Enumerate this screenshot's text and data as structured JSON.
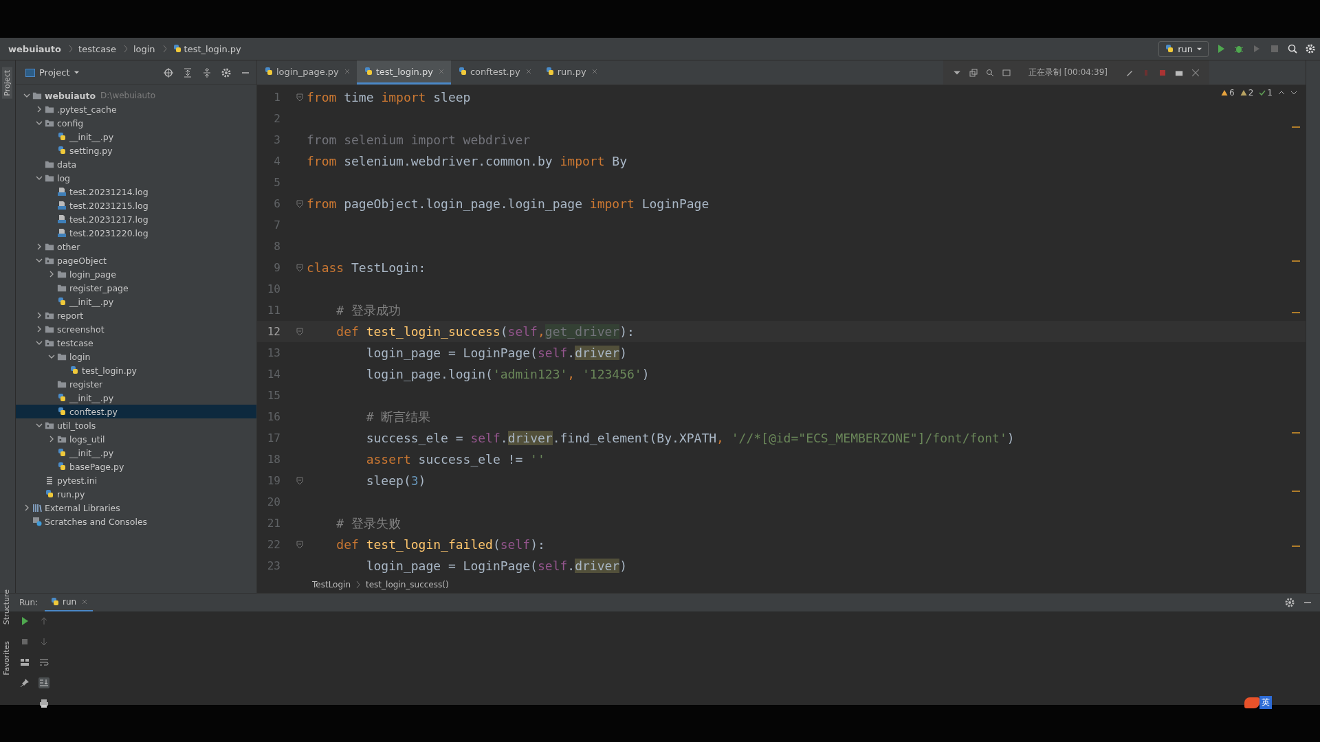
{
  "breadcrumb": [
    {
      "label": "webuiauto",
      "kind": "root"
    },
    {
      "label": "testcase",
      "kind": "dir"
    },
    {
      "label": "login",
      "kind": "dir"
    },
    {
      "label": "test_login.py",
      "kind": "file"
    }
  ],
  "run_config": {
    "label": "run"
  },
  "project_panel": {
    "title": "Project"
  },
  "tabs": [
    {
      "label": "login_page.py",
      "selected": false
    },
    {
      "label": "test_login.py",
      "selected": true
    },
    {
      "label": "conftest.py",
      "selected": false
    },
    {
      "label": "run.py",
      "selected": false
    }
  ],
  "recorder": {
    "status": "正在录制 [00:04:39]"
  },
  "inspections": [
    {
      "kind": "warning",
      "count": "6"
    },
    {
      "kind": "weak",
      "count": "2"
    },
    {
      "kind": "ok",
      "count": "1"
    }
  ],
  "tree": [
    {
      "label": "webuiauto",
      "hint": "D:\\webuiauto",
      "kind": "folder",
      "expanded": true,
      "selected": false,
      "children": [
        {
          "label": ".pytest_cache",
          "kind": "folder",
          "expanded": false,
          "selected": false
        },
        {
          "label": "config",
          "kind": "package",
          "expanded": true,
          "selected": false,
          "children": [
            {
              "label": "__init__.py",
              "kind": "py",
              "selected": false
            },
            {
              "label": "setting.py",
              "kind": "py",
              "selected": false
            }
          ]
        },
        {
          "label": "data",
          "kind": "folder",
          "selected": false
        },
        {
          "label": "log",
          "kind": "folder",
          "expanded": true,
          "selected": false,
          "children": [
            {
              "label": "test.20231214.log",
              "kind": "log",
              "selected": false
            },
            {
              "label": "test.20231215.log",
              "kind": "log",
              "selected": false
            },
            {
              "label": "test.20231217.log",
              "kind": "log",
              "selected": false
            },
            {
              "label": "test.20231220.log",
              "kind": "log",
              "selected": false
            }
          ]
        },
        {
          "label": "other",
          "kind": "folder",
          "expanded": false,
          "selected": false
        },
        {
          "label": "pageObject",
          "kind": "package",
          "expanded": true,
          "selected": false,
          "children": [
            {
              "label": "login_page",
              "kind": "folder",
              "expanded": false,
              "selected": false
            },
            {
              "label": "register_page",
              "kind": "folder",
              "selected": false
            },
            {
              "label": "__init__.py",
              "kind": "py",
              "selected": false
            }
          ]
        },
        {
          "label": "report",
          "kind": "package",
          "expanded": false,
          "selected": false
        },
        {
          "label": "screenshot",
          "kind": "folder",
          "expanded": false,
          "selected": false
        },
        {
          "label": "testcase",
          "kind": "package",
          "expanded": true,
          "selected": false,
          "children": [
            {
              "label": "login",
              "kind": "folder",
              "expanded": true,
              "selected": false,
              "children": [
                {
                  "label": "test_login.py",
                  "kind": "py",
                  "selected": false
                }
              ]
            },
            {
              "label": "register",
              "kind": "folder",
              "selected": false
            },
            {
              "label": "__init__.py",
              "kind": "py",
              "selected": false
            },
            {
              "label": "conftest.py",
              "kind": "py",
              "selected": true
            }
          ]
        },
        {
          "label": "util_tools",
          "kind": "package",
          "expanded": true,
          "selected": false,
          "children": [
            {
              "label": "logs_util",
              "kind": "package",
              "expanded": false,
              "selected": false
            },
            {
              "label": "__init__.py",
              "kind": "py",
              "selected": false
            },
            {
              "label": "basePage.py",
              "kind": "py",
              "selected": false
            }
          ]
        },
        {
          "label": "pytest.ini",
          "kind": "ini",
          "selected": false
        },
        {
          "label": "run.py",
          "kind": "py",
          "selected": false
        }
      ]
    },
    {
      "label": "External Libraries",
      "kind": "lib",
      "expanded": false,
      "selected": false
    },
    {
      "label": "Scratches and Consoles",
      "kind": "scratch",
      "selected": false
    }
  ],
  "code": [
    {
      "num": "1",
      "fold": true,
      "current": false,
      "tokens": [
        {
          "t": "from",
          "kind": "keyword"
        },
        {
          "t": " time ",
          "kind": "plain"
        },
        {
          "t": "import",
          "kind": "keyword"
        },
        {
          "t": " sleep",
          "kind": "plain"
        }
      ]
    },
    {
      "num": "2",
      "fold": false,
      "current": false
    },
    {
      "num": "3",
      "fold": false,
      "current": false,
      "tokens": [
        {
          "t": "from selenium import webdriver",
          "kind": "unused"
        }
      ]
    },
    {
      "num": "4",
      "fold": false,
      "current": false,
      "tokens": [
        {
          "t": "from",
          "kind": "keyword"
        },
        {
          "t": " selenium.webdriver.common.by ",
          "kind": "plain"
        },
        {
          "t": "import",
          "kind": "keyword"
        },
        {
          "t": " By",
          "kind": "plain"
        }
      ]
    },
    {
      "num": "5",
      "fold": false,
      "current": false
    },
    {
      "num": "6",
      "fold": true,
      "current": false,
      "tokens": [
        {
          "t": "from",
          "kind": "keyword"
        },
        {
          "t": " pageObject.login_page.login_page ",
          "kind": "plain"
        },
        {
          "t": "import",
          "kind": "keyword"
        },
        {
          "t": " LoginPage",
          "kind": "plain"
        }
      ]
    },
    {
      "num": "7",
      "fold": false,
      "current": false
    },
    {
      "num": "8",
      "fold": false,
      "current": false
    },
    {
      "num": "9",
      "fold": true,
      "current": false,
      "tokens": [
        {
          "t": "class",
          "kind": "keyword"
        },
        {
          "t": " TestLogin:",
          "kind": "plain"
        }
      ]
    },
    {
      "num": "10",
      "fold": false,
      "current": false
    },
    {
      "num": "11",
      "fold": false,
      "current": false,
      "tokens": [
        {
          "t": "    # 登录成功",
          "kind": "comment"
        }
      ]
    },
    {
      "num": "12",
      "fold": true,
      "current": true,
      "tokens": [
        {
          "t": "    def",
          "kind": "keyword"
        },
        {
          "t": " test_login_success",
          "kind": "function"
        },
        {
          "t": "(",
          "kind": "plain"
        },
        {
          "t": "self",
          "kind": "self"
        },
        {
          "t": ",",
          "kind": "punct"
        },
        {
          "t": "get_driver",
          "kind": "param"
        },
        {
          "t": "):",
          "kind": "plain"
        }
      ]
    },
    {
      "num": "13",
      "fold": false,
      "current": false,
      "tokens": [
        {
          "t": "        login_page = LoginPage(",
          "kind": "plain"
        },
        {
          "t": "self",
          "kind": "self"
        },
        {
          "t": ".",
          "kind": "plain"
        },
        {
          "t": "driver",
          "kind": "usage"
        },
        {
          "t": ")",
          "kind": "plain"
        }
      ]
    },
    {
      "num": "14",
      "fold": false,
      "current": false,
      "tokens": [
        {
          "t": "        login_page.login(",
          "kind": "plain"
        },
        {
          "t": "'admin123'",
          "kind": "string"
        },
        {
          "t": ", ",
          "kind": "punct"
        },
        {
          "t": "'123456'",
          "kind": "string"
        },
        {
          "t": ")",
          "kind": "plain"
        }
      ]
    },
    {
      "num": "15",
      "fold": false,
      "current": false
    },
    {
      "num": "16",
      "fold": false,
      "current": false,
      "tokens": [
        {
          "t": "        # 断言结果",
          "kind": "comment"
        }
      ]
    },
    {
      "num": "17",
      "fold": false,
      "current": false,
      "tokens": [
        {
          "t": "        success_ele = ",
          "kind": "plain"
        },
        {
          "t": "self",
          "kind": "self"
        },
        {
          "t": ".",
          "kind": "plain"
        },
        {
          "t": "driver",
          "kind": "usage"
        },
        {
          "t": ".find_element(By.XPATH",
          "kind": "plain"
        },
        {
          "t": ", ",
          "kind": "punct"
        },
        {
          "t": "'//*[@id=\"ECS_MEMBERZONE\"]/font/font'",
          "kind": "string"
        },
        {
          "t": ")",
          "kind": "plain"
        }
      ]
    },
    {
      "num": "18",
      "fold": false,
      "current": false,
      "tokens": [
        {
          "t": "        assert",
          "kind": "keyword"
        },
        {
          "t": " success_ele != ",
          "kind": "plain"
        },
        {
          "t": "''",
          "kind": "string"
        }
      ]
    },
    {
      "num": "19",
      "fold": true,
      "current": false,
      "tokens": [
        {
          "t": "        sleep(",
          "kind": "plain"
        },
        {
          "t": "3",
          "kind": "number"
        },
        {
          "t": ")",
          "kind": "plain"
        }
      ]
    },
    {
      "num": "20",
      "fold": false,
      "current": false
    },
    {
      "num": "21",
      "fold": false,
      "current": false,
      "tokens": [
        {
          "t": "    # 登录失败",
          "kind": "comment"
        }
      ]
    },
    {
      "num": "22",
      "fold": true,
      "current": false,
      "tokens": [
        {
          "t": "    def",
          "kind": "keyword"
        },
        {
          "t": " test_login_failed",
          "kind": "function"
        },
        {
          "t": "(",
          "kind": "plain"
        },
        {
          "t": "self",
          "kind": "self"
        },
        {
          "t": "):",
          "kind": "plain"
        }
      ]
    },
    {
      "num": "23",
      "fold": false,
      "current": false,
      "tokens": [
        {
          "t": "        login_page = LoginPage(",
          "kind": "plain"
        },
        {
          "t": "self",
          "kind": "self"
        },
        {
          "t": ".",
          "kind": "plain"
        },
        {
          "t": "driver",
          "kind": "usage"
        },
        {
          "t": ")",
          "kind": "plain"
        }
      ]
    }
  ],
  "editor_breadcrumb": [
    "TestLogin",
    "test_login_success()"
  ],
  "run_panel": {
    "title": "Run:",
    "tabs": [
      {
        "label": "run",
        "selected": true
      }
    ]
  },
  "side_tabs": [
    {
      "label": "Project",
      "selected": true
    },
    {
      "label": "Structure",
      "selected": false
    },
    {
      "label": "Favorites",
      "selected": false
    }
  ],
  "ime": {
    "label": "英"
  }
}
